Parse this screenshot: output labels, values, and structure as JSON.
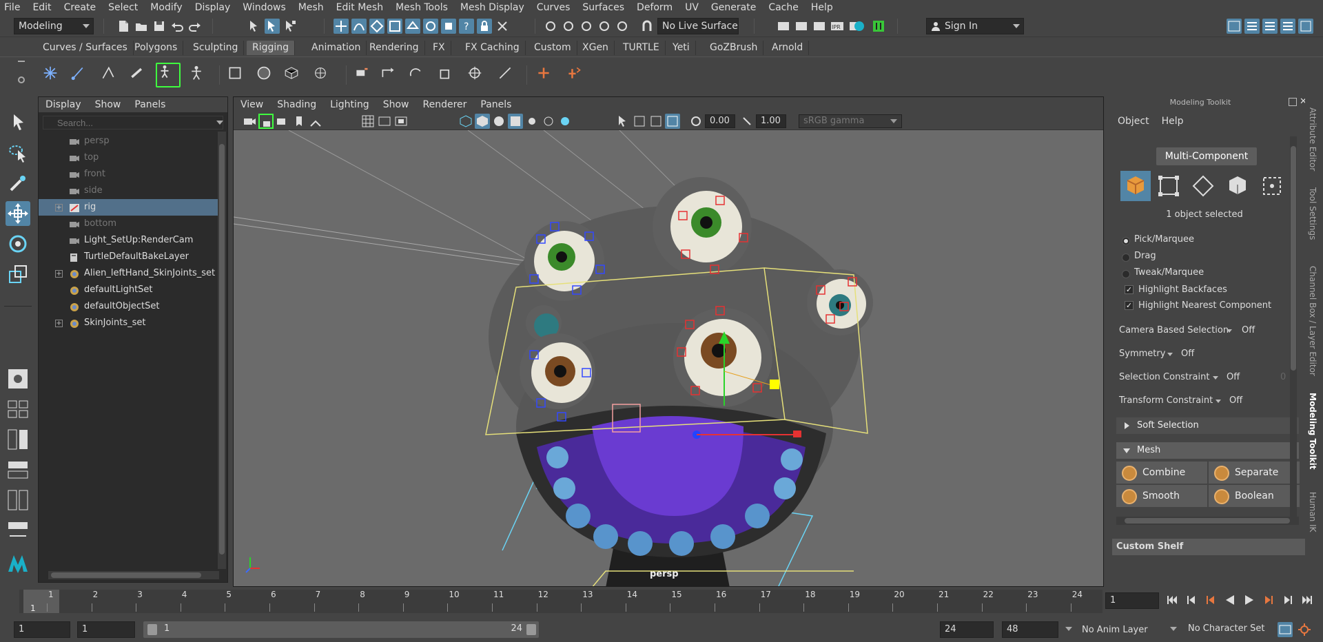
{
  "menu": [
    "File",
    "Edit",
    "Create",
    "Select",
    "Modify",
    "Display",
    "Windows",
    "Mesh",
    "Edit Mesh",
    "Mesh Tools",
    "Mesh Display",
    "Curves",
    "Surfaces",
    "Deform",
    "UV",
    "Generate",
    "Cache",
    "Help"
  ],
  "status": {
    "workspace": "Modeling",
    "live_surface": "No Live Surface",
    "sign_in": "Sign In"
  },
  "shelf_tabs": [
    "Curves / Surfaces",
    "Polygons",
    "Sculpting",
    "Rigging",
    "Animation",
    "Rendering",
    "FX",
    "FX Caching",
    "Custom",
    "XGen",
    "TURTLE",
    "Yeti",
    "GoZBrush",
    "Arnold"
  ],
  "shelf_active": "Rigging",
  "outliner": {
    "menus": [
      "Display",
      "Show",
      "Panels"
    ],
    "search_placeholder": "Search...",
    "items": [
      {
        "label": "persp",
        "kind": "camera",
        "dim": true
      },
      {
        "label": "top",
        "kind": "camera",
        "dim": true
      },
      {
        "label": "front",
        "kind": "camera",
        "dim": true
      },
      {
        "label": "side",
        "kind": "camera",
        "dim": true
      },
      {
        "label": "rig",
        "kind": "rig",
        "selected": true,
        "expand": true
      },
      {
        "label": "bottom",
        "kind": "camera",
        "dim": true
      },
      {
        "label": "Light_SetUp:RenderCam",
        "kind": "camera"
      },
      {
        "label": "TurtleDefaultBakeLayer",
        "kind": "layer"
      },
      {
        "label": "Alien_leftHand_SkinJoints_set",
        "kind": "set",
        "expand": true
      },
      {
        "label": "defaultLightSet",
        "kind": "set"
      },
      {
        "label": "defaultObjectSet",
        "kind": "set"
      },
      {
        "label": "SkinJoints_set",
        "kind": "set",
        "expand": true
      }
    ]
  },
  "viewport": {
    "menus": [
      "View",
      "Shading",
      "Lighting",
      "Show",
      "Renderer",
      "Panels"
    ],
    "exposure": "0.00",
    "gamma": "1.00",
    "color_space": "sRGB gamma",
    "camera_label": "persp"
  },
  "toolkit": {
    "title": "Modeling Toolkit",
    "menus": [
      "Object",
      "Help"
    ],
    "multi_component": "Multi-Component",
    "selection_status": "1 object selected",
    "radio_options": [
      "Pick/Marquee",
      "Drag",
      "Tweak/Marquee"
    ],
    "radio_selected": 0,
    "checks": [
      "Highlight Backfaces",
      "Highlight Nearest Component"
    ],
    "properties": [
      {
        "label": "Camera Based Selection",
        "value": "Off"
      },
      {
        "label": "Symmetry",
        "value": "Off"
      },
      {
        "label": "Selection Constraint",
        "value": "Off",
        "extra": "0"
      },
      {
        "label": "Transform Constraint",
        "value": "Off"
      }
    ],
    "soft_selection": "Soft Selection",
    "mesh_section": "Mesh",
    "mesh_buttons": [
      "Combine",
      "Separate",
      "Smooth",
      "Boolean"
    ],
    "custom_shelf": "Custom Shelf"
  },
  "side_tabs": [
    "Attribute Editor",
    "Tool Settings",
    "Channel Box / Layer Editor",
    "Modeling Toolkit",
    "Human IK"
  ],
  "side_tab_active": "Modeling Toolkit",
  "timeline": {
    "ticks": [
      "1",
      "2",
      "3",
      "4",
      "5",
      "6",
      "7",
      "8",
      "9",
      "10",
      "11",
      "12",
      "13",
      "14",
      "15",
      "16",
      "17",
      "18",
      "19",
      "20",
      "21",
      "22",
      "23",
      "24"
    ],
    "current_frame": "1",
    "frame_field": "1"
  },
  "range": {
    "start": "1",
    "playback_start": "1",
    "bar_start": "1",
    "bar_end": "24",
    "playback_end": "24",
    "end": "48",
    "anim_layer": "No Anim Layer",
    "character_set": "No Character Set"
  },
  "colors": {
    "accent": "#5285a6",
    "panel": "#444444",
    "field": "#2b2b2b",
    "viewport_bg": "#6b6b6b"
  }
}
